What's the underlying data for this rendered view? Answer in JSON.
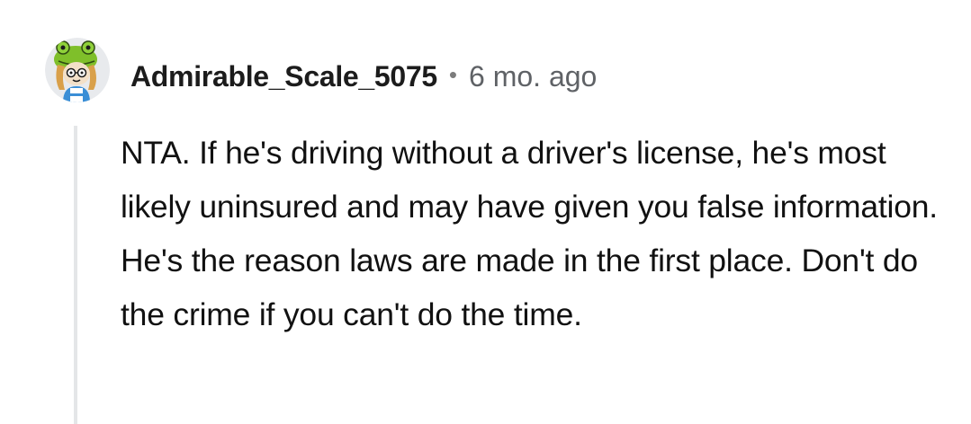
{
  "comment": {
    "author": "Admirable_Scale_5075",
    "separator": "•",
    "timestamp": "6 mo. ago",
    "body": "NTA. If he's driving without a driver's license, he's most likely uninsured and may have given you false information. He's the reason laws are made in the first place. Don't do the crime if you can't do the time."
  },
  "avatar": {
    "icon": "snoo-avatar-icon",
    "background_color": "#e8eaed",
    "accent_color": "#7fbf2a"
  },
  "colors": {
    "username": "#1c1c1c",
    "meta": "#5f6266",
    "body_text": "#111111",
    "thread_line": "#e4e6e8"
  }
}
